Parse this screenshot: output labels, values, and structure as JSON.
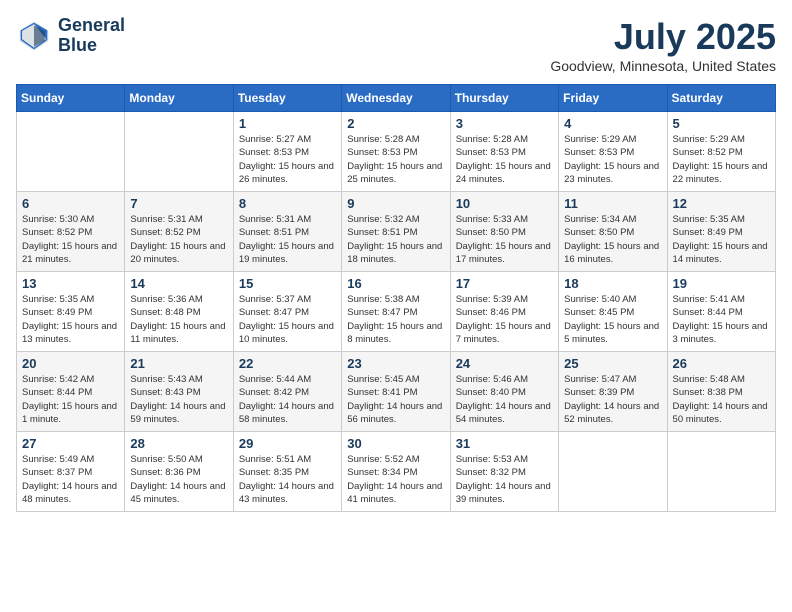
{
  "header": {
    "logo_line1": "General",
    "logo_line2": "Blue",
    "month_title": "July 2025",
    "location": "Goodview, Minnesota, United States"
  },
  "weekdays": [
    "Sunday",
    "Monday",
    "Tuesday",
    "Wednesday",
    "Thursday",
    "Friday",
    "Saturday"
  ],
  "weeks": [
    [
      {
        "day": "",
        "empty": true
      },
      {
        "day": "",
        "empty": true
      },
      {
        "day": "1",
        "sunrise": "Sunrise: 5:27 AM",
        "sunset": "Sunset: 8:53 PM",
        "daylight": "Daylight: 15 hours and 26 minutes."
      },
      {
        "day": "2",
        "sunrise": "Sunrise: 5:28 AM",
        "sunset": "Sunset: 8:53 PM",
        "daylight": "Daylight: 15 hours and 25 minutes."
      },
      {
        "day": "3",
        "sunrise": "Sunrise: 5:28 AM",
        "sunset": "Sunset: 8:53 PM",
        "daylight": "Daylight: 15 hours and 24 minutes."
      },
      {
        "day": "4",
        "sunrise": "Sunrise: 5:29 AM",
        "sunset": "Sunset: 8:53 PM",
        "daylight": "Daylight: 15 hours and 23 minutes."
      },
      {
        "day": "5",
        "sunrise": "Sunrise: 5:29 AM",
        "sunset": "Sunset: 8:52 PM",
        "daylight": "Daylight: 15 hours and 22 minutes."
      }
    ],
    [
      {
        "day": "6",
        "sunrise": "Sunrise: 5:30 AM",
        "sunset": "Sunset: 8:52 PM",
        "daylight": "Daylight: 15 hours and 21 minutes."
      },
      {
        "day": "7",
        "sunrise": "Sunrise: 5:31 AM",
        "sunset": "Sunset: 8:52 PM",
        "daylight": "Daylight: 15 hours and 20 minutes."
      },
      {
        "day": "8",
        "sunrise": "Sunrise: 5:31 AM",
        "sunset": "Sunset: 8:51 PM",
        "daylight": "Daylight: 15 hours and 19 minutes."
      },
      {
        "day": "9",
        "sunrise": "Sunrise: 5:32 AM",
        "sunset": "Sunset: 8:51 PM",
        "daylight": "Daylight: 15 hours and 18 minutes."
      },
      {
        "day": "10",
        "sunrise": "Sunrise: 5:33 AM",
        "sunset": "Sunset: 8:50 PM",
        "daylight": "Daylight: 15 hours and 17 minutes."
      },
      {
        "day": "11",
        "sunrise": "Sunrise: 5:34 AM",
        "sunset": "Sunset: 8:50 PM",
        "daylight": "Daylight: 15 hours and 16 minutes."
      },
      {
        "day": "12",
        "sunrise": "Sunrise: 5:35 AM",
        "sunset": "Sunset: 8:49 PM",
        "daylight": "Daylight: 15 hours and 14 minutes."
      }
    ],
    [
      {
        "day": "13",
        "sunrise": "Sunrise: 5:35 AM",
        "sunset": "Sunset: 8:49 PM",
        "daylight": "Daylight: 15 hours and 13 minutes."
      },
      {
        "day": "14",
        "sunrise": "Sunrise: 5:36 AM",
        "sunset": "Sunset: 8:48 PM",
        "daylight": "Daylight: 15 hours and 11 minutes."
      },
      {
        "day": "15",
        "sunrise": "Sunrise: 5:37 AM",
        "sunset": "Sunset: 8:47 PM",
        "daylight": "Daylight: 15 hours and 10 minutes."
      },
      {
        "day": "16",
        "sunrise": "Sunrise: 5:38 AM",
        "sunset": "Sunset: 8:47 PM",
        "daylight": "Daylight: 15 hours and 8 minutes."
      },
      {
        "day": "17",
        "sunrise": "Sunrise: 5:39 AM",
        "sunset": "Sunset: 8:46 PM",
        "daylight": "Daylight: 15 hours and 7 minutes."
      },
      {
        "day": "18",
        "sunrise": "Sunrise: 5:40 AM",
        "sunset": "Sunset: 8:45 PM",
        "daylight": "Daylight: 15 hours and 5 minutes."
      },
      {
        "day": "19",
        "sunrise": "Sunrise: 5:41 AM",
        "sunset": "Sunset: 8:44 PM",
        "daylight": "Daylight: 15 hours and 3 minutes."
      }
    ],
    [
      {
        "day": "20",
        "sunrise": "Sunrise: 5:42 AM",
        "sunset": "Sunset: 8:44 PM",
        "daylight": "Daylight: 15 hours and 1 minute."
      },
      {
        "day": "21",
        "sunrise": "Sunrise: 5:43 AM",
        "sunset": "Sunset: 8:43 PM",
        "daylight": "Daylight: 14 hours and 59 minutes."
      },
      {
        "day": "22",
        "sunrise": "Sunrise: 5:44 AM",
        "sunset": "Sunset: 8:42 PM",
        "daylight": "Daylight: 14 hours and 58 minutes."
      },
      {
        "day": "23",
        "sunrise": "Sunrise: 5:45 AM",
        "sunset": "Sunset: 8:41 PM",
        "daylight": "Daylight: 14 hours and 56 minutes."
      },
      {
        "day": "24",
        "sunrise": "Sunrise: 5:46 AM",
        "sunset": "Sunset: 8:40 PM",
        "daylight": "Daylight: 14 hours and 54 minutes."
      },
      {
        "day": "25",
        "sunrise": "Sunrise: 5:47 AM",
        "sunset": "Sunset: 8:39 PM",
        "daylight": "Daylight: 14 hours and 52 minutes."
      },
      {
        "day": "26",
        "sunrise": "Sunrise: 5:48 AM",
        "sunset": "Sunset: 8:38 PM",
        "daylight": "Daylight: 14 hours and 50 minutes."
      }
    ],
    [
      {
        "day": "27",
        "sunrise": "Sunrise: 5:49 AM",
        "sunset": "Sunset: 8:37 PM",
        "daylight": "Daylight: 14 hours and 48 minutes."
      },
      {
        "day": "28",
        "sunrise": "Sunrise: 5:50 AM",
        "sunset": "Sunset: 8:36 PM",
        "daylight": "Daylight: 14 hours and 45 minutes."
      },
      {
        "day": "29",
        "sunrise": "Sunrise: 5:51 AM",
        "sunset": "Sunset: 8:35 PM",
        "daylight": "Daylight: 14 hours and 43 minutes."
      },
      {
        "day": "30",
        "sunrise": "Sunrise: 5:52 AM",
        "sunset": "Sunset: 8:34 PM",
        "daylight": "Daylight: 14 hours and 41 minutes."
      },
      {
        "day": "31",
        "sunrise": "Sunrise: 5:53 AM",
        "sunset": "Sunset: 8:32 PM",
        "daylight": "Daylight: 14 hours and 39 minutes."
      },
      {
        "day": "",
        "empty": true
      },
      {
        "day": "",
        "empty": true
      }
    ]
  ]
}
